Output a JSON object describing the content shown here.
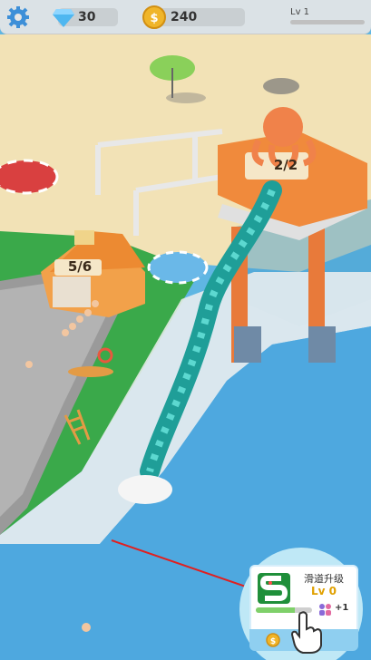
{
  "hud": {
    "gems": "30",
    "coins": "240",
    "level_label": "Lv 1",
    "level_progress": 0.0
  },
  "signs": {
    "building_capacity": "5/6",
    "tower_capacity": "2/2"
  },
  "upgrade_panel": {
    "title": "滑道升级",
    "level": "Lv 0",
    "bonus": "+1",
    "progress": 0.7
  },
  "icons": [
    "gear-icon",
    "gem-icon",
    "coin-icon",
    "slide-upgrade-icon",
    "people-icon",
    "hand-pointer-icon",
    "arrow-indicator"
  ],
  "colors": {
    "water": "#5fb6e3",
    "sand": "#f2e2b6",
    "grass": "#3aa94a",
    "tower_orange": "#f08a3c",
    "slide_teal": "#20a8a0",
    "level_text": "#e0a000"
  }
}
